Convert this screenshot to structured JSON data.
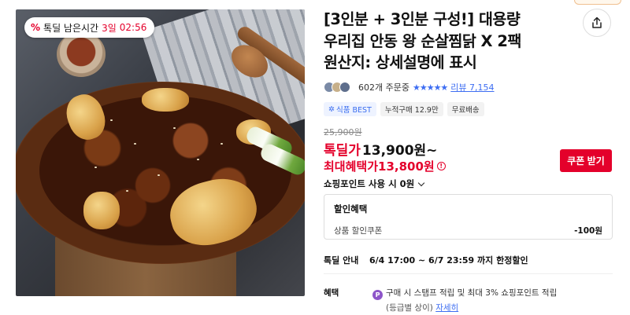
{
  "timer": {
    "label": "톡딜 남은시간",
    "days": "3일",
    "time": "02:56"
  },
  "product": {
    "title_line1": "[3인분 + 3인분 구성!] 대용량",
    "title_line2": "우리집 안동 왕 순살찜닭 X 2팩",
    "title_line3": "원산지: 상세설명에 표시"
  },
  "rating": {
    "orders": "602개 주문중",
    "stars": "★★★★★",
    "review_label": "리뷰 7,154"
  },
  "tags": [
    "식품 BEST",
    "누적구매 12.9만",
    "무료배송"
  ],
  "price": {
    "original": "25,900원",
    "deal_label": "톡딜가",
    "deal_price": "13,900원~",
    "max_label": "최대혜택가",
    "max_price": "13,800원",
    "info_icon": "!"
  },
  "coupon_button": "쿠폰 받기",
  "points_label": "쇼핑포인트 사용 시 0원",
  "discount": {
    "title": "할인혜택",
    "row_label": "상품 할인쿠폰",
    "row_value": "-100원"
  },
  "notice": {
    "label": "톡딜 안내",
    "text": "6/4 17:00 ~ 6/7 23:59 까지 한정할인"
  },
  "benefit": {
    "label": "혜택",
    "icon": "P",
    "line1": "구매 시 스탬프 적립 및 최대 3% 쇼핑포인트 적립",
    "line2": "(등급별 상이)",
    "detail_link": "자세히"
  },
  "colors": {
    "accent_red": "#e4002b",
    "link_blue": "#3d6df2",
    "point_purple": "#8d55c9"
  },
  "icons": {
    "share": "share-icon",
    "percent": "percent-tag-icon",
    "chevron": "chevron-down-icon"
  }
}
